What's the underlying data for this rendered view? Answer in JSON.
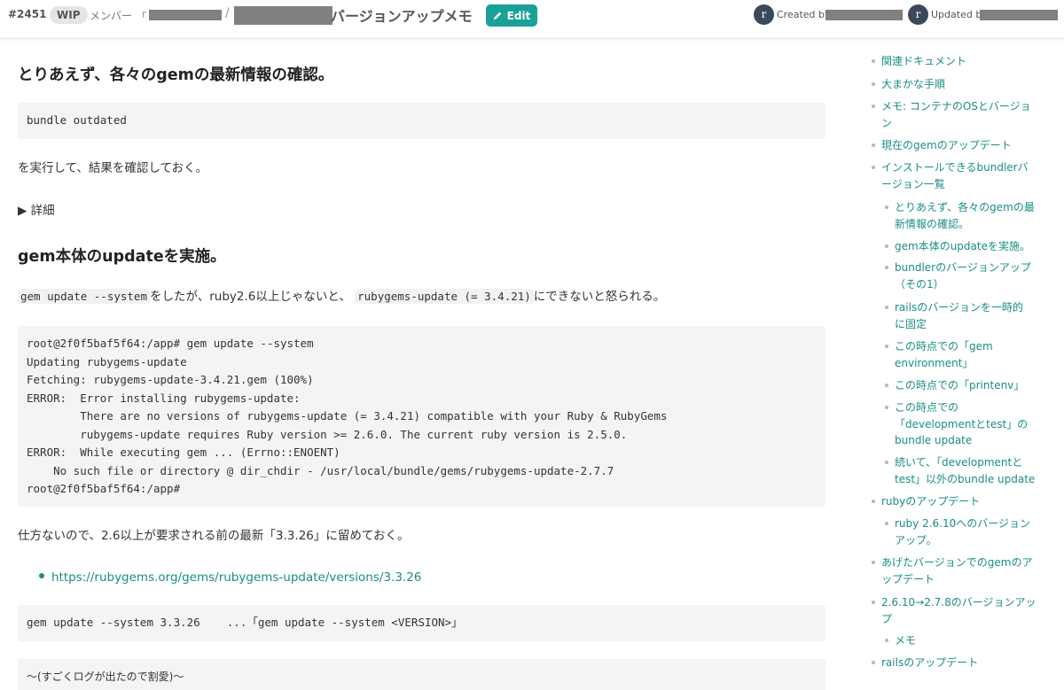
{
  "header": {
    "number": "#2451",
    "wip": "WIP",
    "category": "メンバー",
    "category_sep": "r",
    "slash": "/",
    "title": "バージョンアップメモ",
    "edit_label": "Edit",
    "avatar_letter": "r",
    "created_by": "Created by",
    "updated_by": "Updated by",
    "brand_color": "#1aa197"
  },
  "content": {
    "h1": "とりあえず、各々のgemの最新情報の確認。",
    "code1": "bundle outdated",
    "p1": "を実行して、結果を確認しておく。",
    "details": "▶ 詳細",
    "h2": "gem本体のupdateを実施。",
    "p2_code1": "gem update --system",
    "p2_mid": "をしたが、ruby2.6以上じゃないと、",
    "p2_code2": "rubygems-update (= 3.4.21)",
    "p2_end": "にできないと怒られる。",
    "code2": [
      "root@2f0f5baf5f64:/app# gem update --system",
      "Updating rubygems-update",
      "Fetching: rubygems-update-3.4.21.gem (100%)",
      "ERROR:  Error installing rubygems-update:",
      "        There are no versions of rubygems-update (= 3.4.21) compatible with your Ruby & RubyGems",
      "        rubygems-update requires Ruby version >= 2.6.0. The current ruby version is 2.5.0.",
      "ERROR:  While executing gem ... (Errno::ENOENT)",
      "    No such file or directory @ dir_chdir - /usr/local/bundle/gems/rubygems-update-2.7.7",
      "root@2f0f5baf5f64:/app#"
    ],
    "p3": "仕方ないので、2.6以上が要求される前の最新「3.3.26」に留めておく。",
    "link1": "https://rubygems.org/gems/rubygems-update/versions/3.3.26",
    "code3": "gem update --system 3.3.26    ...「gem update --system <VERSION>」",
    "code4": "〜(すごくログが出たので割愛)〜"
  },
  "toc": [
    {
      "label": "関連ドキュメント",
      "level": 1
    },
    {
      "label": "大まかな手順",
      "level": 1
    },
    {
      "label": "メモ: コンテナのOSとバージョ\nン",
      "level": 1
    },
    {
      "label": "現在のgemのアップデート",
      "level": 1
    },
    {
      "label": "インストールできるbundlerバ\nージョン一覧",
      "level": 1
    },
    {
      "label": "とりあえず、各々のgemの最\n新情報の確認。",
      "level": 2
    },
    {
      "label": "gem本体のupdateを実施。",
      "level": 2
    },
    {
      "label": "bundlerのバージョンアップ\n（その1）",
      "level": 2
    },
    {
      "label": "railsのバージョンを一時的\nに固定",
      "level": 2
    },
    {
      "label": "この時点での「gem\nenvironment」",
      "level": 2
    },
    {
      "label": "この時点での「printenv」",
      "level": 2
    },
    {
      "label": "この時点での\n「developmentとtest」の\nbundle update",
      "level": 2
    },
    {
      "label": "続いて、「developmentと\ntest」以外のbundle update",
      "level": 2
    },
    {
      "label": "rubyのアップデート",
      "level": 1
    },
    {
      "label": "ruby 2.6.10へのバージョン\nアップ。",
      "level": 2
    },
    {
      "label": "あげたバージョンでのgemのア\nップデート",
      "level": 1
    },
    {
      "label": "2.6.10→2.7.8のバージョンアッ\nプ",
      "level": 1
    },
    {
      "label": "メモ",
      "level": 2
    },
    {
      "label": "railsのアップデート",
      "level": 1
    }
  ]
}
